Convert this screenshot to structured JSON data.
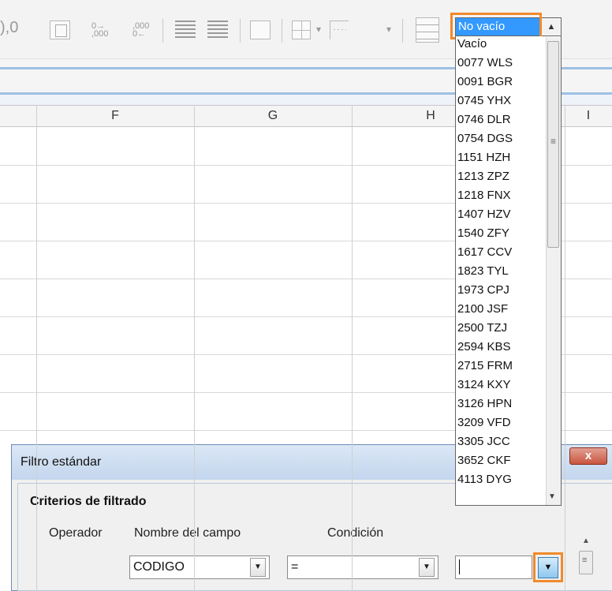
{
  "toolbar": {
    "decimal_fragment": "),0",
    "icons": [
      "date-format-icon",
      "add-decimal-icon",
      "remove-decimal-icon",
      "increase-indent-icon",
      "decrease-indent-icon",
      "borders-icon",
      "border-style-icon",
      "toggle-grid-icon"
    ]
  },
  "columns": [
    "F",
    "G",
    "H",
    "I"
  ],
  "filter_dropdown": {
    "selected": "No vacío",
    "options": [
      "Vacío",
      "0077 WLS",
      "0091 BGR",
      "0745 YHX",
      "0746 DLR",
      "0754 DGS",
      "1151 HZH",
      "1213 ZPZ",
      "1218 FNX",
      "1407 HZV",
      "1540 ZFY",
      "1617 CCV",
      "1823 TYL",
      "1973 CPJ",
      "2100 JSF",
      "2500 TZJ",
      "2594 KBS",
      "2715 FRM",
      "3124 KXY",
      "3126 HPN",
      "3209 VFD",
      "3305 JCC",
      "3652 CKF",
      "4113 DYG"
    ]
  },
  "dialog": {
    "title": "Filtro estándar",
    "close_label": "x",
    "section": "Criterios de filtrado",
    "headers": {
      "operator": "Operador",
      "field": "Nombre del campo",
      "condition": "Condición"
    },
    "row1": {
      "field": "CODIGO",
      "condition": "=",
      "value": ""
    }
  },
  "colors": {
    "highlight": "#3399ff",
    "annotation": "#f08a2c",
    "band": "#9ec0e3"
  }
}
